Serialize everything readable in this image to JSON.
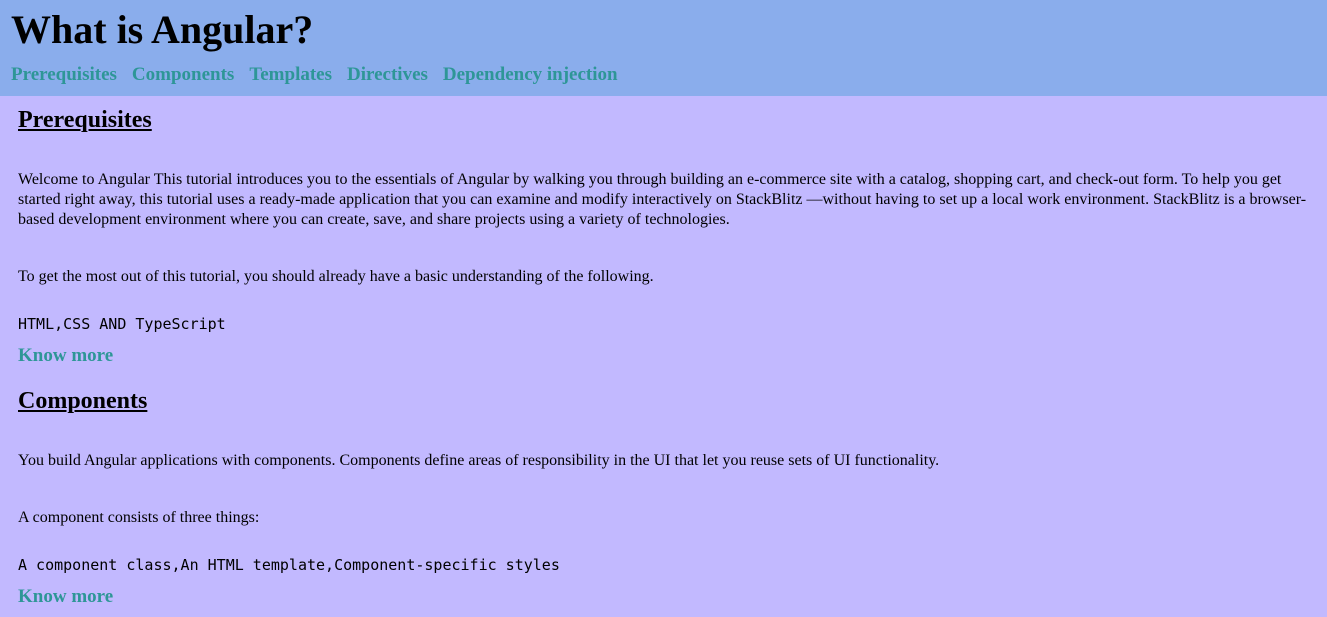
{
  "header": {
    "title": "What is Angular?",
    "nav": [
      "Prerequisites",
      "Components",
      "Templates",
      "Directives",
      "Dependency injection"
    ]
  },
  "sections": [
    {
      "title": "Prerequisites",
      "para1": "Welcome to Angular This tutorial introduces you to the essentials of Angular by walking you through building an e-commerce site with a catalog, shopping cart, and check-out form. To help you get started right away, this tutorial uses a ready-made application that you can examine and modify interactively on StackBlitz —without having to set up a local work environment. StackBlitz is a browser-based development environment where you can create, save, and share projects using a variety of technologies.",
      "para2": "To get the most out of this tutorial, you should already have a basic understanding of the following.",
      "code": "HTML,CSS AND TypeScript",
      "link": "Know more"
    },
    {
      "title": "Components",
      "para1": "You build Angular applications with components. Components define areas of responsibility in the UI that let you reuse sets of UI functionality.",
      "para2": "A component consists of three things:",
      "code": "A component class,An HTML template,Component-specific styles",
      "link": "Know more"
    }
  ]
}
